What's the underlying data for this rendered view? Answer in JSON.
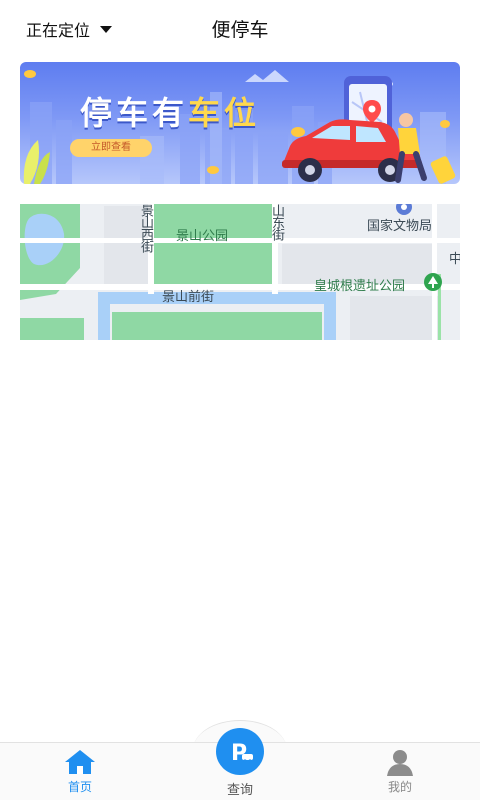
{
  "header": {
    "location_label": "正在定位",
    "title": "便停车"
  },
  "banner": {
    "title_part1": "停车有",
    "title_part2": "车位",
    "button_label": "立即查看"
  },
  "map": {
    "labels": {
      "jingshan_park": "景山公园",
      "jingshan_west": "景山西街",
      "shandong_street": "山东街",
      "museum_bureau": "国家文物局",
      "jingshan_front": "景山前街",
      "huangcheng_park": "皇城根遗址公园",
      "zhong": "中"
    }
  },
  "bottom_nav": {
    "home": "首页",
    "query": "查询",
    "mine": "我的"
  },
  "colors": {
    "accent": "#1f8ff0",
    "banner_bg": "#6f89f2",
    "map_green": "#8fd8a4",
    "map_water": "#a9d0f8"
  },
  "icons": {
    "location_dropdown": "caret-down-icon",
    "home": "home-icon",
    "query": "parking-icon",
    "mine": "user-icon",
    "park_marker": "tree-icon",
    "museum_marker": "pin-icon"
  }
}
